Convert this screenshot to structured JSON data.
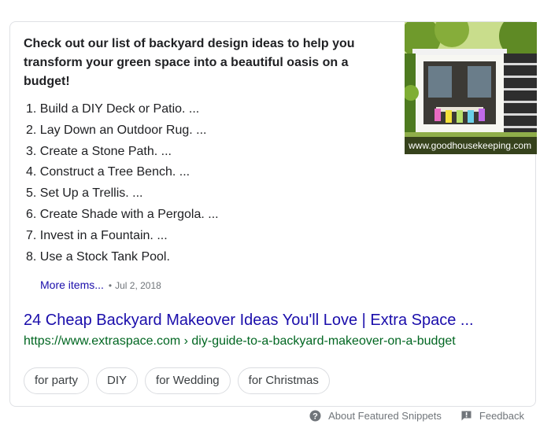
{
  "snippet": {
    "headline": "Check out our list of backyard design ideas to help you transform your green space into a beautiful oasis on a budget!",
    "steps": [
      "1. Build a DIY Deck or Patio. ...",
      "2. Lay Down an Outdoor Rug. ...",
      "3. Create a Stone Path. ...",
      "4. Construct a Tree Bench. ...",
      "5. Set Up a Trellis. ...",
      "6. Create Shade with a Pergola. ...",
      "7. Invest in a Fountain. ...",
      "8. Use a Stock Tank Pool."
    ],
    "more_items": "More items...",
    "separator": "•",
    "date": "Jul 2, 2018",
    "image_caption": "www.goodhousekeeping.com"
  },
  "result": {
    "title": "24 Cheap Backyard Makeover Ideas You'll Love | Extra Space ...",
    "url": "https://www.extraspace.com › diy-guide-to-a-backyard-makeover-on-a-budget"
  },
  "chips": [
    "for party",
    "DIY",
    "for Wedding",
    "for Christmas"
  ],
  "footer": {
    "about": "About Featured Snippets",
    "feedback": "Feedback"
  },
  "colors": {
    "link": "#1a0dab",
    "url_green": "#006621",
    "muted": "#70757a",
    "border": "#dfe1e5"
  }
}
